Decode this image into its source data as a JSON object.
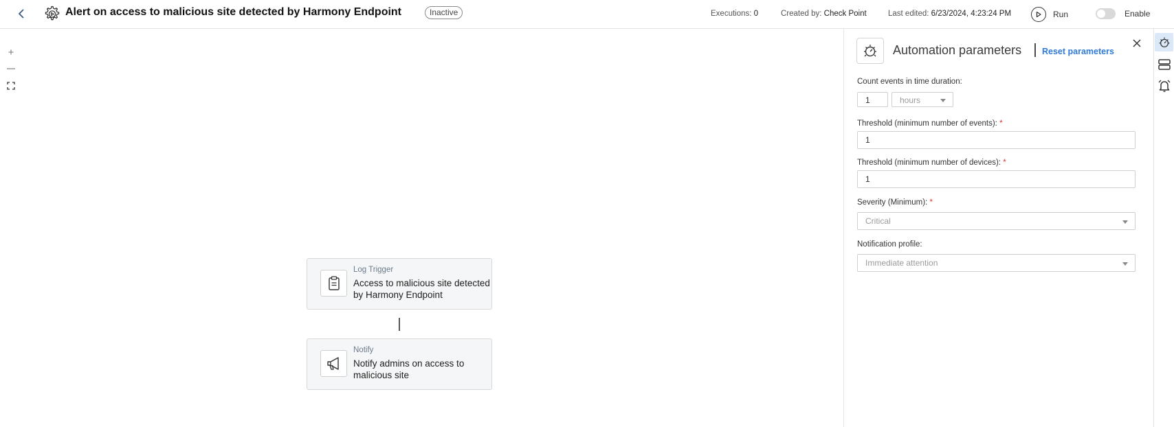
{
  "header": {
    "title": "Alert on access to malicious site detected by Harmony Endpoint",
    "status_badge": "Inactive",
    "executions_label": "Executions:",
    "executions_value": "0",
    "created_by_label": "Created by:",
    "created_by_value": "Check Point",
    "last_edited_label": "Last edited:",
    "last_edited_value": "6/23/2024, 4:23:24 PM",
    "run_label": "Run",
    "enable_label": "Enable",
    "enable_state": "off"
  },
  "canvas": {
    "zoom_in": "+",
    "zoom_out": "—",
    "nodes": [
      {
        "type": "Log Trigger",
        "title": "Access to malicious site detected by Harmony Endpoint",
        "icon": "clipboard-icon"
      },
      {
        "type": "Notify",
        "title": "Notify admins on access to malicious site",
        "icon": "megaphone-icon"
      }
    ]
  },
  "panel": {
    "title": "Automation parameters",
    "reset_label": "Reset parameters",
    "fields": {
      "count_label": "Count events in time duration:",
      "count_value": "1",
      "count_unit": "hours",
      "threshold_events_label": "Threshold (minimum number of events):",
      "threshold_events_value": "1",
      "threshold_devices_label": "Threshold (minimum number of devices):",
      "threshold_devices_value": "1",
      "severity_label": "Severity (Minimum):",
      "severity_value": "Critical",
      "notification_label": "Notification profile:",
      "notification_value": "Immediate attention"
    },
    "required_mark": "*"
  },
  "rail": {
    "icons": [
      "automation-icon",
      "layers-icon",
      "alarm-icon"
    ],
    "active": "automation-icon"
  },
  "colors": {
    "accent": "#2f7bd8",
    "required": "#e03131",
    "rail_active_bg": "#dbe8f7"
  }
}
